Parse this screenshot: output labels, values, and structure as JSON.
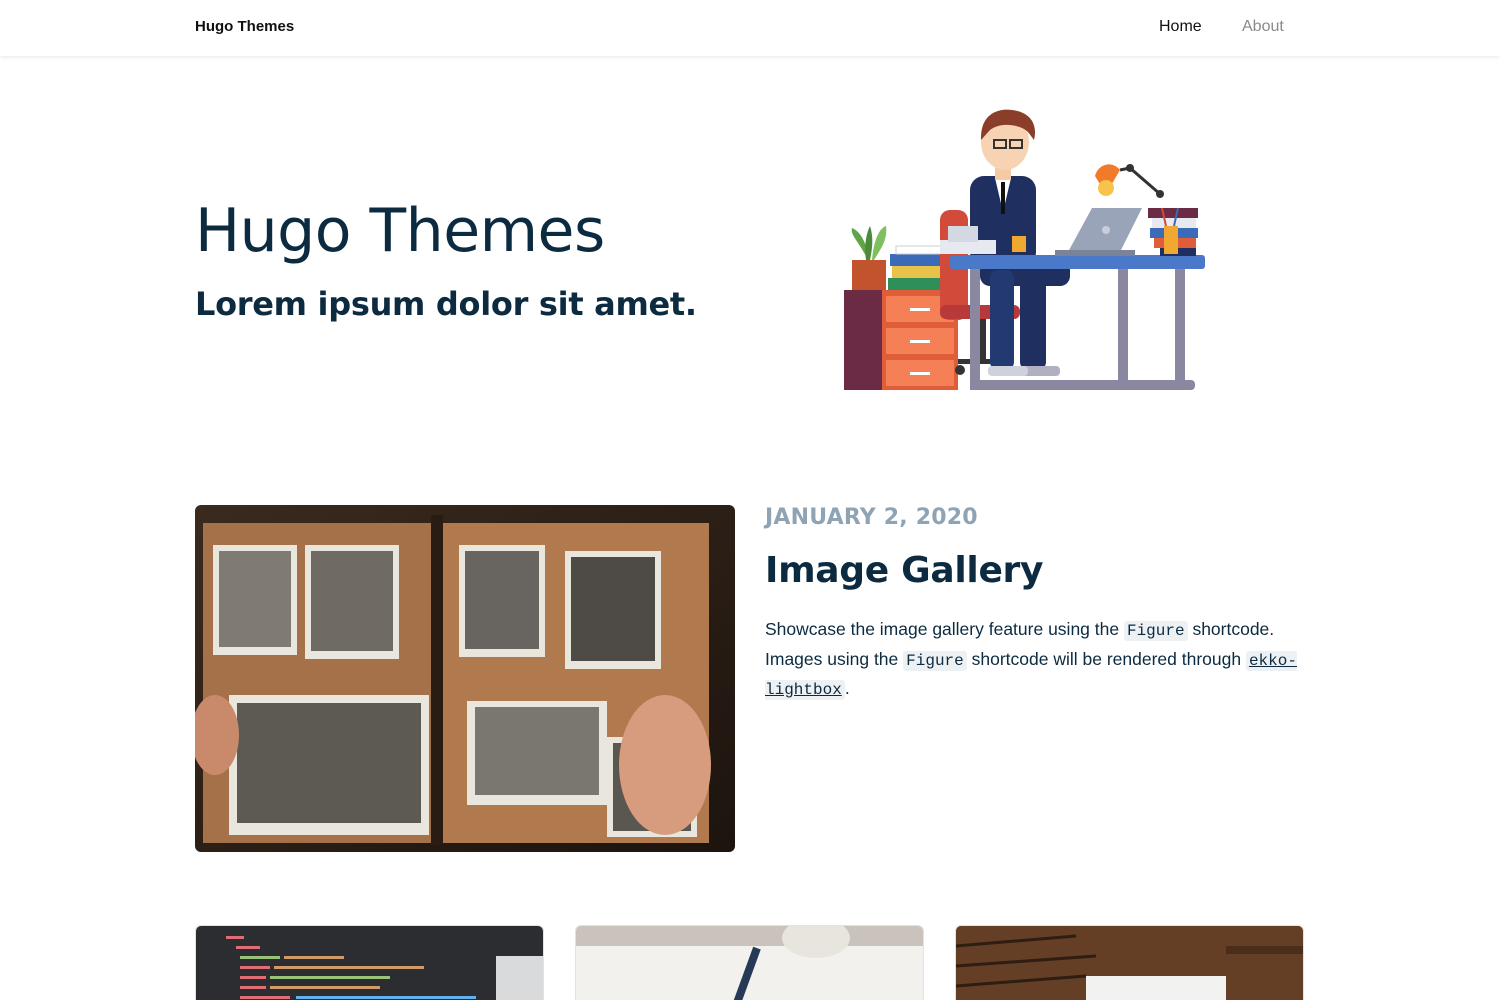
{
  "navbar": {
    "brand": "Hugo Themes",
    "links": [
      {
        "label": "Home",
        "active": true
      },
      {
        "label": "About",
        "active": false
      }
    ]
  },
  "hero": {
    "title": "Hugo Themes",
    "subtitle": "Lorem ipsum dolor sit amet.",
    "illustration": "office-worker-at-desk-illustration"
  },
  "featured_post": {
    "date": "JANUARY 2, 2020",
    "title": "Image Gallery",
    "summary": {
      "part1": "Showcase the image gallery feature using the ",
      "code1": "Figure",
      "part2": " shortcode. Images using the ",
      "code2": "Figure",
      "part3": " shortcode will be rendered through ",
      "code3": "ekko-lightbox",
      "part4": "."
    },
    "image": "photo-album-image"
  },
  "cards": [
    {
      "image": "code-editor-image"
    },
    {
      "image": "writing-notebook-image"
    },
    {
      "image": "spiral-notebook-image"
    }
  ],
  "colors": {
    "heading": "#0c2b40",
    "date": "#8ea4b5",
    "nav_inactive": "#8a8a8a",
    "code_bg": "#eef1f4"
  }
}
